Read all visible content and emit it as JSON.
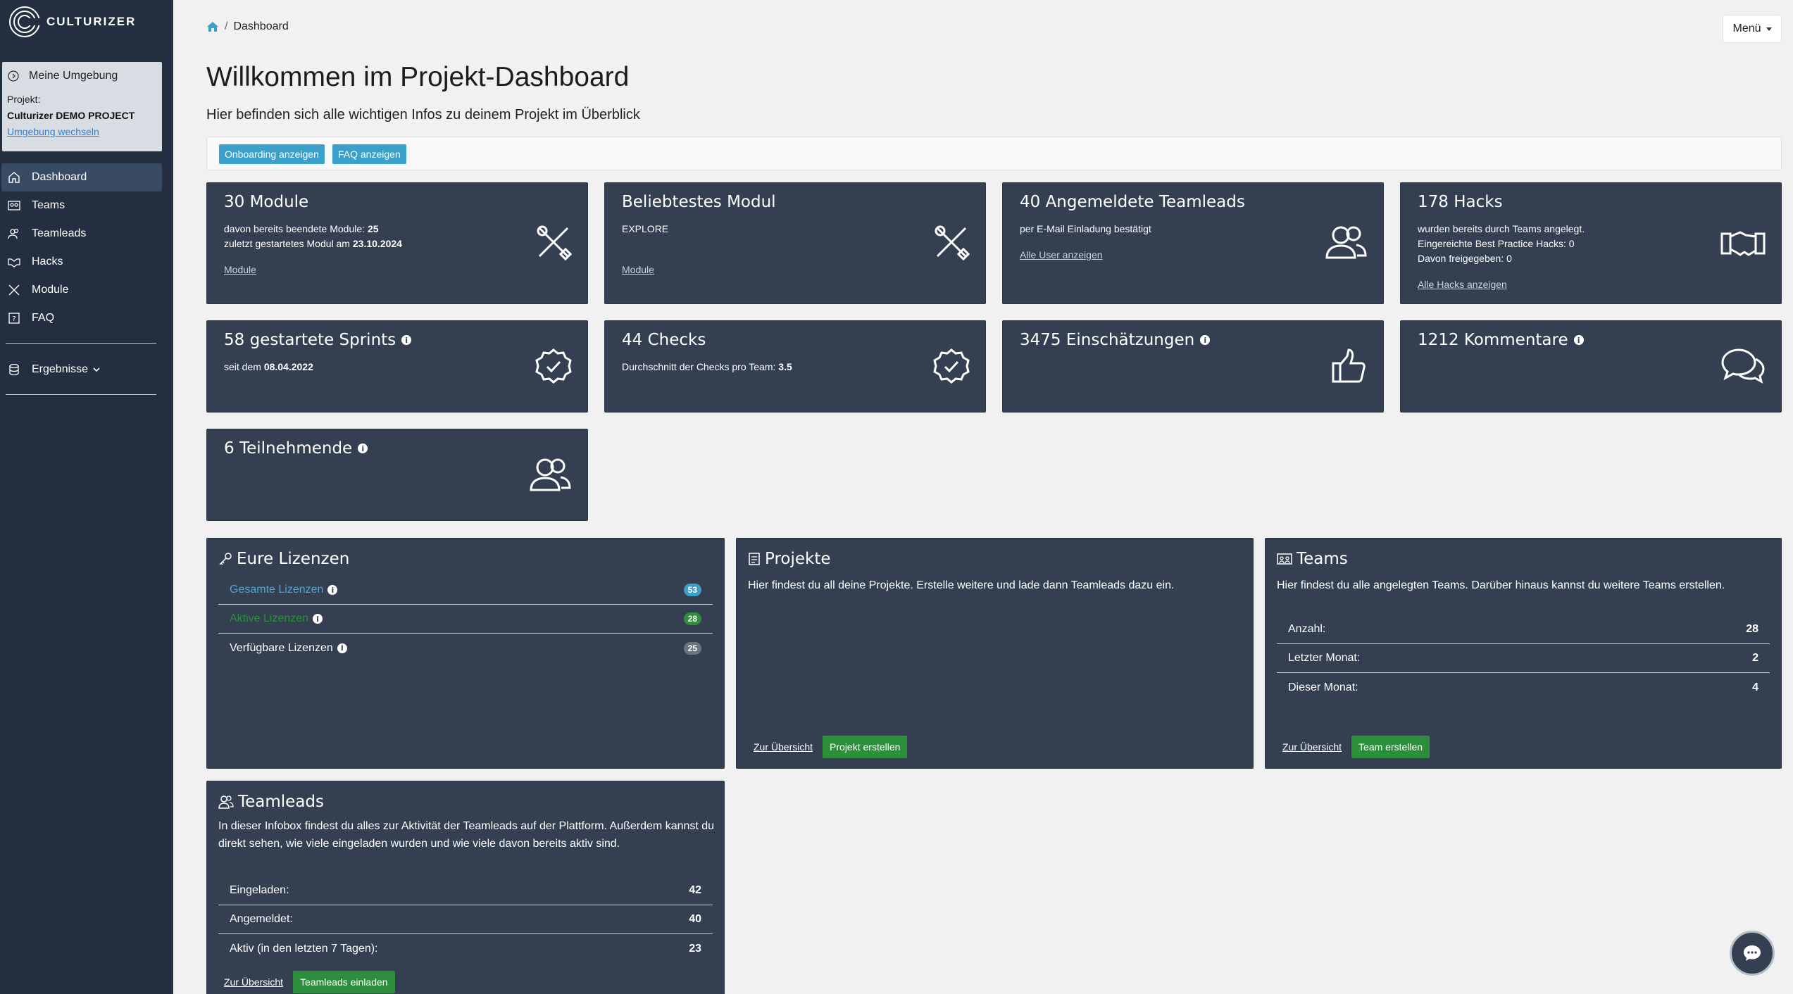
{
  "sidebar": {
    "brand": "CULTURIZER",
    "env": {
      "title": "Meine Umgebung",
      "project_label": "Projekt:",
      "project_name": "Culturizer DEMO PROJECT",
      "switch_link": "Umgebung wechseln"
    },
    "items": [
      {
        "label": "Dashboard",
        "icon": "home-icon",
        "active": true
      },
      {
        "label": "Teams",
        "icon": "teams-icon"
      },
      {
        "label": "Teamleads",
        "icon": "users-icon"
      },
      {
        "label": "Hacks",
        "icon": "handshake-icon"
      },
      {
        "label": "Module",
        "icon": "tools-icon"
      },
      {
        "label": "FAQ",
        "icon": "question-icon"
      }
    ],
    "results": "Ergebnisse"
  },
  "topbar": {
    "breadcrumb": "Dashboard",
    "menu": "Menü"
  },
  "header": {
    "title": "Willkommen im Projekt-Dashboard",
    "subtitle": "Hier befinden sich alle wichtigen Infos zu deinem Projekt im Überblick",
    "btn_onboarding": "Onboarding anzeigen",
    "btn_faq": "FAQ anzeigen"
  },
  "cards": {
    "modules": {
      "title": "30 Module",
      "line1_prefix": "davon bereits beendete Module: ",
      "line1_value": "25",
      "line2_prefix": "zuletzt gestartetes Modul am ",
      "line2_value": "23.10.2024",
      "link": "Module"
    },
    "favorite": {
      "title": "Beliebtestes Modul",
      "line1": "EXPLORE",
      "link": "Module"
    },
    "teamleads": {
      "title": "40 Angemeldete Teamleads",
      "line1": "per E-Mail Einladung bestätigt",
      "link": "Alle User anzeigen"
    },
    "hacks": {
      "title": "178 Hacks",
      "line1": "wurden bereits durch Teams angelegt.",
      "line2": "Eingereichte Best Practice Hacks: 0",
      "line3": "Davon freigegeben: 0",
      "link": "Alle Hacks anzeigen"
    },
    "sprints": {
      "title": "58 gestartete Sprints",
      "line1_prefix": "seit dem ",
      "line1_value": "08.04.2022"
    },
    "checks": {
      "title": "44 Checks",
      "line1_prefix": "Durchschnitt der Checks pro Team: ",
      "line1_value": "3.5"
    },
    "ratings": {
      "title": "3475 Einschätzungen"
    },
    "comments": {
      "title": "1212 Kommentare"
    },
    "participants": {
      "title": "6 Teilnehmende"
    }
  },
  "licenses": {
    "title": "Eure Lizenzen",
    "rows": [
      {
        "label": "Gesamte Lizenzen",
        "value": "53",
        "label_color": "#4aa8d8",
        "badge_color": "#3aa0c9"
      },
      {
        "label": "Aktive Lizenzen",
        "value": "28",
        "label_color": "#2d8f3c",
        "badge_color": "#2d8f3c"
      },
      {
        "label": "Verfügbare Lizenzen",
        "value": "25",
        "label_color": "#ffffff",
        "badge_color": "#6c757d"
      }
    ]
  },
  "projects": {
    "title": "Projekte",
    "text": "Hier findest du all deine Projekte. Erstelle weitere und lade dann Teamleads dazu ein.",
    "link": "Zur Übersicht",
    "button": "Projekt erstellen"
  },
  "teams": {
    "title": "Teams",
    "text": "Hier findest du alle angelegten Teams. Darüber hinaus kannst du weitere Teams erstellen.",
    "rows": [
      {
        "label": "Anzahl:",
        "value": "28"
      },
      {
        "label": "Letzter Monat:",
        "value": "2"
      },
      {
        "label": "Dieser Monat:",
        "value": "4"
      }
    ],
    "link": "Zur Übersicht",
    "button": "Team erstellen"
  },
  "teamleads_panel": {
    "title": "Teamleads",
    "text": "In dieser Infobox findest du alles zur Aktivität der Teamleads auf der Plattform. Außerdem kannst du direkt sehen, wie viele eingeladen wurden und wie viele davon bereits aktiv sind.",
    "rows": [
      {
        "label": "Eingeladen:",
        "value": "42"
      },
      {
        "label": "Angemeldet:",
        "value": "40"
      },
      {
        "label": "Aktiv (in den letzten 7 Tagen):",
        "value": "23"
      }
    ],
    "link": "Zur Übersicht",
    "button": "Teamleads einladen"
  },
  "colors": {
    "sidebar": "#232f40",
    "card": "#344052",
    "info": "#3aa0c9",
    "success": "#2d8f3c"
  }
}
